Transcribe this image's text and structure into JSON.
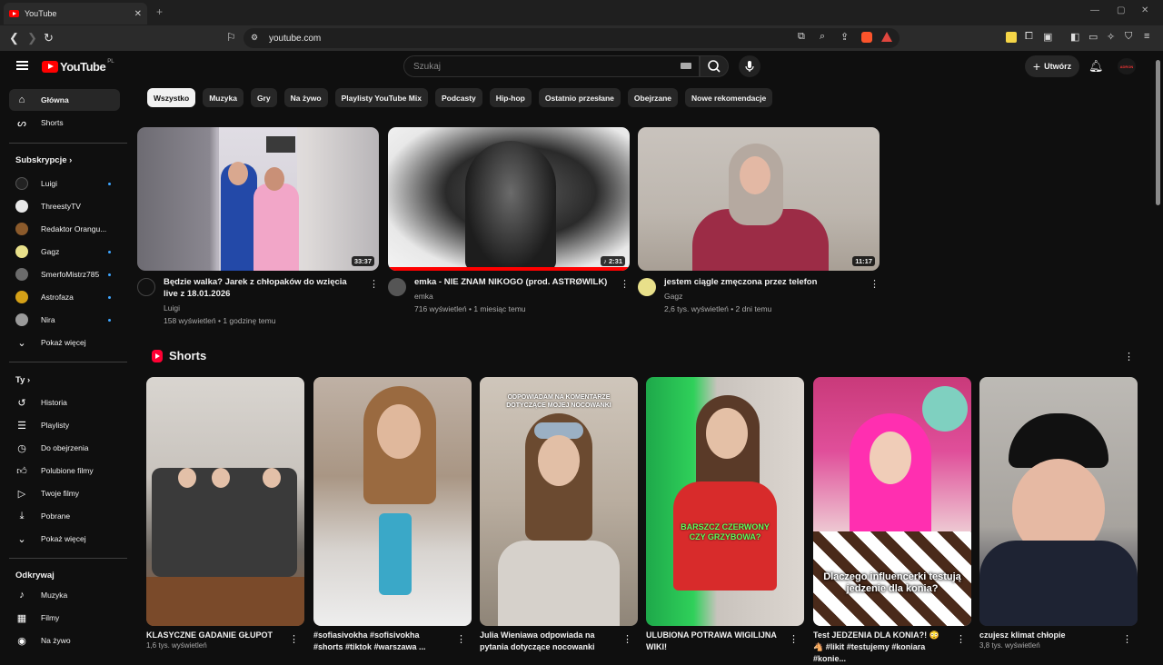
{
  "browser": {
    "tab_title": "YouTube",
    "tab_close": "✕",
    "new_tab": "+",
    "url": "youtube.com"
  },
  "header": {
    "logo_text": "YouTube",
    "region": "PL",
    "search_placeholder": "Szukaj",
    "create_label": "Utwórz",
    "avatar_text": "ADRON"
  },
  "sidebar": {
    "main": [
      {
        "label": "Główna",
        "icon": "home-icon"
      },
      {
        "label": "Shorts",
        "icon": "shorts-icon"
      }
    ],
    "subs_heading": "Subskrypcje",
    "subs": [
      {
        "label": "Luigi",
        "color": "#222222"
      },
      {
        "label": "ThreestyTV",
        "color": "#e8e8e8"
      },
      {
        "label": "Redaktor Orangu...",
        "color": "#8b5a2b"
      },
      {
        "label": "Gagz",
        "color": "#e8e08a"
      },
      {
        "label": "SmerfoMistrz785",
        "color": "#6b6b6b"
      },
      {
        "label": "Astrofaza",
        "color": "#d4a017"
      },
      {
        "label": "Nira",
        "color": "#9a9a9a"
      }
    ],
    "show_more": "Pokaż więcej",
    "you_heading": "Ty",
    "you_items": [
      {
        "label": "Historia",
        "icon": "history-icon"
      },
      {
        "label": "Playlisty",
        "icon": "playlist-icon"
      },
      {
        "label": "Do obejrzenia",
        "icon": "watch-later-icon"
      },
      {
        "label": "Polubione filmy",
        "icon": "like-icon"
      },
      {
        "label": "Twoje filmy",
        "icon": "your-videos-icon"
      },
      {
        "label": "Pobrane",
        "icon": "download-icon"
      }
    ],
    "show_more2": "Pokaż więcej",
    "explore_heading": "Odkrywaj",
    "explore_items": [
      {
        "label": "Muzyka",
        "icon": "music-icon"
      },
      {
        "label": "Filmy",
        "icon": "film-icon"
      },
      {
        "label": "Na żywo",
        "icon": "live-icon"
      }
    ]
  },
  "chips": [
    "Wszystko",
    "Muzyka",
    "Gry",
    "Na żywo",
    "Playlisty YouTube Mix",
    "Podcasty",
    "Hip-hop",
    "Ostatnio przesłane",
    "Obejrzane",
    "Nowe rekomendacje"
  ],
  "videos": [
    {
      "title": "Będzie walka? Jarek z chłopaków do wzięcia live z 18.01.2026",
      "channel": "Luigi",
      "stats": "158 wyświetleń • 1 godzinę temu",
      "duration": "33:37"
    },
    {
      "title": "emka - NIE ZNAM NIKOGO (prod. ASTRØWILK)",
      "channel": "emka",
      "stats": "716 wyświetleń • 1 miesiąc temu",
      "duration": "♪ 2:31"
    },
    {
      "title": "jestem ciągle zmęczona przez telefon",
      "channel": "Gagz",
      "stats": "2,6 tys. wyświetleń • 2 dni temu",
      "duration": "11:17"
    }
  ],
  "shorts_heading": "Shorts",
  "shorts": [
    {
      "title": "KLASYCZNE GADANIE GŁUPOT",
      "views": "1,6 tys. wyświetleń"
    },
    {
      "title": "#sofiasivokha #sofisivokha #shorts #tiktok #warszawa ...",
      "views": ""
    },
    {
      "title": "Julia Wieniawa odpowiada na pytania dotyczące nocowanki",
      "views": "",
      "overlay": "ODPOWIADAM NA KOMENTARZE DOTYCZĄCE MOJEJ NOCOWANKI"
    },
    {
      "title": "ULUBIONA POTRAWA WIGILIJNA WIKI!",
      "views": "",
      "overlay": "BARSZCZ CZERWONY CZY GRZYBOWA?",
      "overlay_top": "BARSZCZ"
    },
    {
      "title": "Test JEDZENIA DLA KONIA?! 😳 🐴 #likit #testujemy #koniara #konie...",
      "views": "",
      "overlay": "Dlaczego influencerki testują jedzenie dla konia?"
    },
    {
      "title": "czujesz klimat chłopie",
      "views": "3,8 tys. wyświetleń"
    }
  ]
}
